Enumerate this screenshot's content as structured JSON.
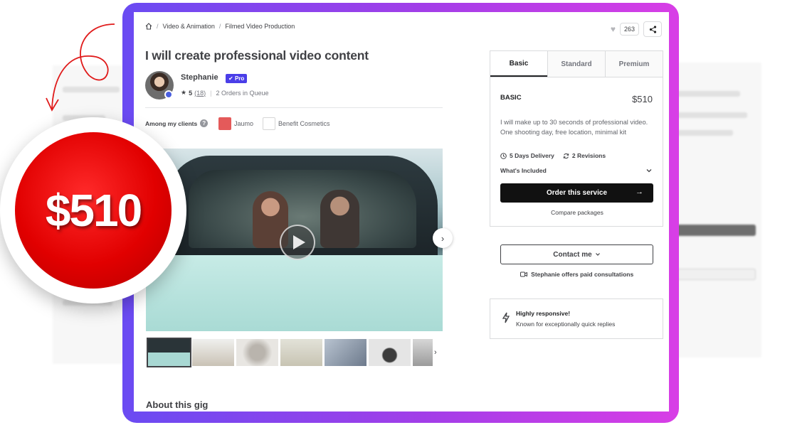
{
  "price_badge": {
    "amount": "$510",
    "color": "#e10000"
  },
  "breadcrumb": {
    "home_icon": "home-icon",
    "items": [
      "Video & Animation",
      "Filmed Video Production"
    ],
    "separator": "/"
  },
  "actions": {
    "like_count": "263",
    "heart_icon": "heart-icon",
    "share_icon": "share-icon"
  },
  "gig": {
    "title": "I will create professional video content"
  },
  "seller": {
    "name": "Stephanie",
    "badge": "Pro",
    "rating": "5",
    "reviews": "(18)",
    "queue": "2 Orders in Queue"
  },
  "clients": {
    "label": "Among my clients",
    "items": [
      {
        "name": "Jaumo",
        "logo_color": "#e45a5a"
      },
      {
        "name": "Benefit Cosmetics",
        "logo_color": "#ffffff"
      }
    ]
  },
  "media": {
    "thumbnail_count": 7
  },
  "about_heading": "About this gig",
  "package": {
    "tabs": [
      "Basic",
      "Standard",
      "Premium"
    ],
    "active_tab": "Basic",
    "name": "BASIC",
    "price": "$510",
    "description": "I will make up to 30 seconds of professional video. One shooting day, free location, minimal kit",
    "delivery": "5 Days Delivery",
    "revisions": "2 Revisions",
    "included_label": "What's Included",
    "order_button": "Order this service",
    "compare_link": "Compare packages"
  },
  "contact": {
    "button": "Contact me",
    "consultation": "Stephanie offers paid consultations"
  },
  "responsive": {
    "title": "Highly responsive!",
    "subtitle": "Known for exceptionally quick replies"
  }
}
